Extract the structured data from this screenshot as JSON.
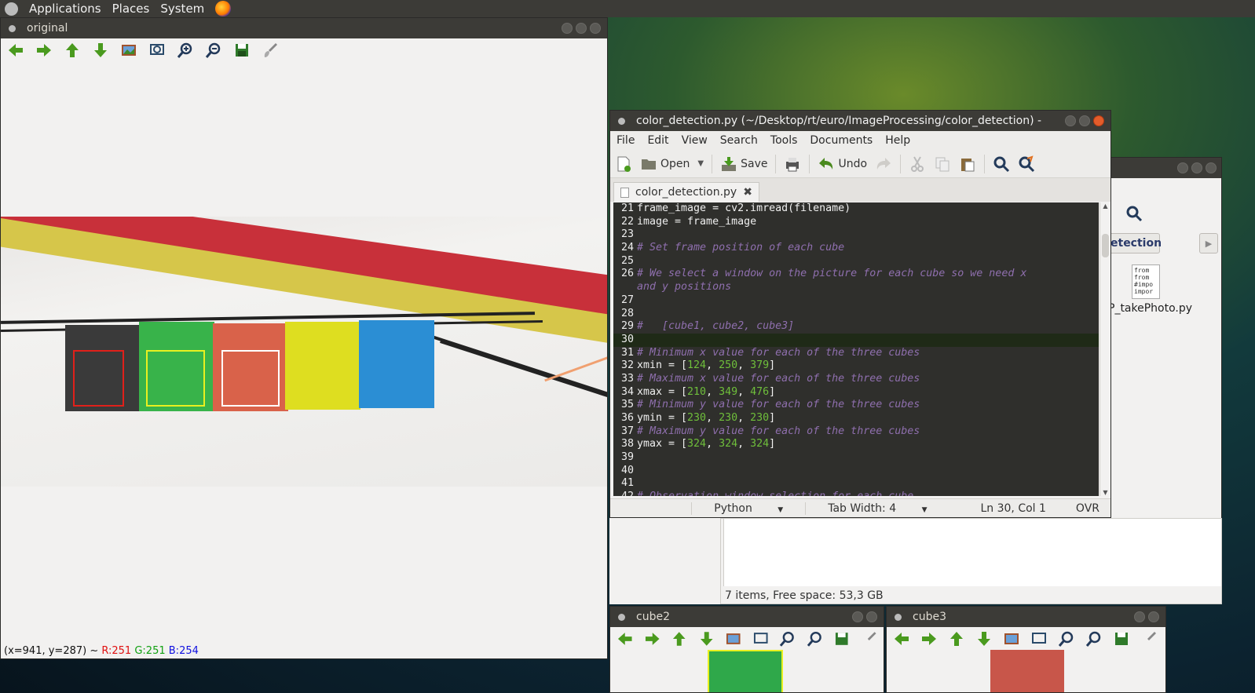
{
  "top_panel": {
    "applications": "Applications",
    "places": "Places",
    "system": "System"
  },
  "original_window": {
    "title": "original",
    "status": {
      "coords": "(x=941, y=287) ~",
      "r": "R:251",
      "g": "G:251",
      "b": "B:254"
    }
  },
  "gedit": {
    "title": "color_detection.py (~/Desktop/rt/euro/ImageProcessing/color_detection) -",
    "menu": [
      "File",
      "Edit",
      "View",
      "Search",
      "Tools",
      "Documents",
      "Help"
    ],
    "toolbar": {
      "open": "Open",
      "save": "Save",
      "undo": "Undo"
    },
    "tab_name": "color_detection.py",
    "status": {
      "language": "Python",
      "tab_width": "Tab Width: 4",
      "position": "Ln 30, Col 1",
      "mode": "OVR"
    },
    "lines": [
      {
        "n": "21",
        "code": "frame_image = cv2.imread(filename)"
      },
      {
        "n": "22",
        "code": "image = frame_image"
      },
      {
        "n": "23",
        "code": ""
      },
      {
        "n": "24",
        "comment": "# Set frame position of each cube"
      },
      {
        "n": "25",
        "code": ""
      },
      {
        "n": "26",
        "comment": "# We select a window on the picture for each cube so we need x\nand y positions"
      },
      {
        "n": "27",
        "code": ""
      },
      {
        "n": "28",
        "code": ""
      },
      {
        "n": "29",
        "comment": "#   [cube1, cube2, cube3]"
      },
      {
        "n": "30",
        "code": ""
      },
      {
        "n": "31",
        "comment": "# Minimum x value for each of the three cubes"
      },
      {
        "n": "32",
        "prefix": "xmin = [",
        "nums": [
          "124",
          "250",
          "379"
        ]
      },
      {
        "n": "33",
        "comment": "# Maximum x value for each of the three cubes"
      },
      {
        "n": "34",
        "prefix": "xmax = [",
        "nums": [
          "210",
          "349",
          "476"
        ]
      },
      {
        "n": "35",
        "comment": "# Minimum y value for each of the three cubes"
      },
      {
        "n": "36",
        "prefix": "ymin = [",
        "nums": [
          "230",
          "230",
          "230"
        ]
      },
      {
        "n": "37",
        "comment": "# Maximum y value for each of the three cubes"
      },
      {
        "n": "38",
        "prefix": "ymax = [",
        "nums": [
          "324",
          "324",
          "324"
        ]
      },
      {
        "n": "39",
        "code": ""
      },
      {
        "n": "40",
        "code": ""
      },
      {
        "n": "41",
        "code": ""
      },
      {
        "n": "42",
        "comment": "# Observation window selection for each cube"
      }
    ]
  },
  "file_manager": {
    "breadcrumb": "etection",
    "file_name": "P_takePhoto.py",
    "file_preview": [
      "from",
      "from",
      "#impo",
      "impor"
    ],
    "status": "7 items, Free space: 53,3 GB"
  },
  "cube2_window": {
    "title": "cube2",
    "swatch": "#2fa84a"
  },
  "cube3_window": {
    "title": "cube3",
    "swatch": "#c8564a"
  },
  "colors": {
    "arrow_green": "#4a9a1e",
    "panel_bg": "#3c3b37",
    "comment": "#8f6fae",
    "number": "#6fbf3b"
  }
}
